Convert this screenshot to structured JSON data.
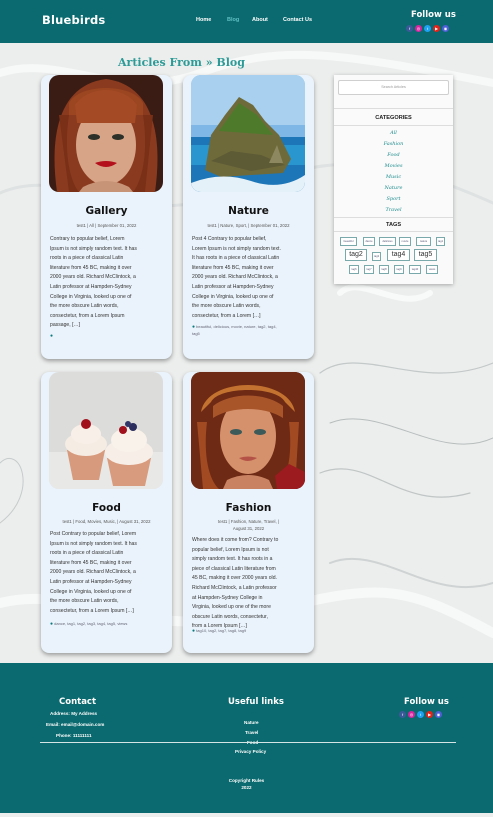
{
  "header": {
    "brand": "Bluebirds",
    "nav": [
      {
        "label": "Home",
        "active": false
      },
      {
        "label": "Blog",
        "active": true
      },
      {
        "label": "About",
        "active": false
      },
      {
        "label": "Contact Us",
        "active": false
      }
    ],
    "follow_title": "Follow us"
  },
  "social_icons": [
    {
      "name": "facebook-icon",
      "color": "#3b5998"
    },
    {
      "name": "instagram-icon",
      "color": "#d6249f"
    },
    {
      "name": "twitter-icon",
      "color": "#1da1f2"
    },
    {
      "name": "youtube-icon",
      "color": "#e62117"
    },
    {
      "name": "discord-icon",
      "color": "#4e5fd6"
    }
  ],
  "page_title": "Articles From » Blog",
  "posts": [
    {
      "title": "Gallery",
      "meta": [
        "test1 | All | September 01, 2022"
      ],
      "body": [
        "Contrary to popular belief, Lorem",
        "Ipsum is not simply random text. It has",
        "roots in a piece of classical Latin",
        "literature from 45 BC, making it over",
        "2000 years old. Richard McClintock, a",
        "Latin professor at Hampden-Sydney",
        "College in Virginia, looked up one of",
        "the more obscure Latin words,",
        "consectetur, from a Lorem Ipsum",
        "passage, […]"
      ],
      "tags": []
    },
    {
      "title": "Nature",
      "meta": [
        "test1 | Nature, Sport, | September 01, 2022"
      ],
      "body": [
        "Post 4 Contrary to popular belief,",
        "Lorem Ipsum is not simply random text.",
        "It has roots in a piece of classical Latin",
        "literature from 45 BC, making it over",
        "2000 years old. Richard McClintock, a",
        "Latin professor at Hampden-Sydney",
        "College in Virginia, looked up one of",
        "the more obscure Latin words,",
        "consectetur, from a Lorem […]"
      ],
      "tags": [
        "beautiful, delicious, movie, nature, tag2, tag4,",
        "tag5"
      ]
    },
    {
      "title": "Food",
      "meta": [
        "test1 | Food, Movies, Music, | August 31, 2022"
      ],
      "body": [
        "Post Contrary to popular belief, Lorem",
        "Ipsum is not simply random text. It has",
        "roots in a piece of classical Latin",
        "literature from 45 BC, making it over",
        "2000 years old. Richard McClintock, a",
        "Latin professor at Hampden-Sydney",
        "College in Virginia, looked up one of",
        "the more obscure Latin words,",
        "consectetur, from a Lorem Ipsum […]"
      ],
      "tags": [
        "dance, tag1, tag2, tag3, tag4, tag5, views"
      ]
    },
    {
      "title": "Fashion",
      "meta": [
        "test1 | Fashion, Nature, Travel, |",
        "August 31, 2022"
      ],
      "body": [
        "Where does it come from? Contrary to",
        "popular belief, Lorem Ipsum is not",
        "simply random text. It has roots in a",
        "piece of classical Latin literature from",
        "45 BC, making it over 2000 years old.",
        "Richard McClintock, a Latin professor",
        "at Hampden-Sydney College in",
        "Virginia, looked up one of the more",
        "obscure Latin words, consectetur,",
        "from a Lorem Ipsum […]"
      ],
      "tags": [
        "tag10, tag2, tag7, tag8, tag9"
      ]
    }
  ],
  "sidebar": {
    "search_placeholder": "Search Articles",
    "categories_title": "CATEGORIES",
    "categories": [
      "All",
      "Fashion",
      "Food",
      "Movies",
      "Music",
      "Nature",
      "Sport",
      "Travel"
    ],
    "tags_title": "TAGS",
    "tags": [
      {
        "label": "beautiful",
        "big": false
      },
      {
        "label": "dance",
        "big": false
      },
      {
        "label": "delicious",
        "big": false
      },
      {
        "label": "movie",
        "big": false
      },
      {
        "label": "nature",
        "big": false
      },
      {
        "label": "tag1",
        "big": false
      },
      {
        "label": "tag2",
        "big": true
      },
      {
        "label": "tag3",
        "big": false
      },
      {
        "label": "tag4",
        "big": true
      },
      {
        "label": "tag5",
        "big": true
      },
      {
        "label": "tag6",
        "big": false
      },
      {
        "label": "tag7",
        "big": false
      },
      {
        "label": "tag8",
        "big": false
      },
      {
        "label": "tag9",
        "big": false
      },
      {
        "label": "tag10",
        "big": false
      },
      {
        "label": "views",
        "big": false
      }
    ]
  },
  "footer": {
    "contact_title": "Contact",
    "contact_lines": [
      "Address: My Address",
      "Email: email@domain.com",
      "Phone: 11111111"
    ],
    "links_title": "Useful links",
    "links": [
      "Blog",
      "Nature",
      "Travel",
      "Food",
      "Privacy Policy"
    ],
    "follow_title": "Follow us",
    "copyright": [
      "Copyright Rules",
      "2022"
    ]
  }
}
